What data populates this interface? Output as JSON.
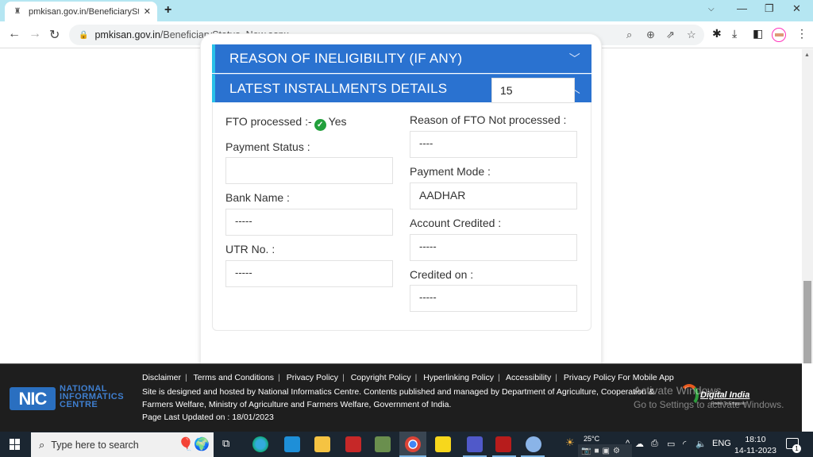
{
  "browser": {
    "tab_title": "pmkisan.gov.in/BeneficiaryStatus",
    "url_domain": "pmkisan.gov.in",
    "url_path": "/BeneficiaryStatus_New.aspx"
  },
  "sections": {
    "ineligibility_title": "REASON OF INELIGIBILITY (IF ANY)",
    "installments_title": "LATEST INSTALLMENTS DETAILS",
    "installment_selected": "15"
  },
  "details": {
    "fto_label": "FTO processed :-",
    "fto_value": "Yes",
    "payment_status_label": "Payment Status :",
    "payment_status_value": "",
    "bank_name_label": "Bank Name :",
    "bank_name_value": "-----",
    "utr_label": "UTR No. :",
    "utr_value": "-----",
    "fto_reason_label": "Reason of FTO Not processed :",
    "fto_reason_value": "----",
    "payment_mode_label": "Payment Mode :",
    "payment_mode_value": "AADHAR",
    "account_credited_label": "Account Credited :",
    "account_credited_value": "-----",
    "credited_on_label": "Credited on :",
    "credited_on_value": "-----"
  },
  "footer": {
    "links": [
      "Disclaimer",
      "Terms and Conditions",
      "Privacy Policy",
      "Copyright Policy",
      "Hyperlinking Policy",
      "Accessibility",
      "Privacy Policy For Mobile App"
    ],
    "line1": "Site is designed and hosted by National Informatics Centre. Contents published and managed by Department of Agriculture, Cooperation &",
    "line2": "Farmers Welfare, Ministry of Agriculture and Farmers Welfare, Government of India.",
    "updated": "Page Last Updated on : 18/01/2023",
    "nic_logo": "NIC",
    "nic_name_1": "NATIONAL",
    "nic_name_2": "INFORMATICS",
    "nic_name_3": "CENTRE",
    "digital_india": "Digital India",
    "digital_india_tag": "Power To Empower"
  },
  "watermark": {
    "line1": "Activate Windows",
    "line2": "Go to Settings to activate Windows."
  },
  "taskbar": {
    "search_placeholder": "Type here to search",
    "weather": "25°C",
    "language": "ENG",
    "time": "18:10",
    "date": "14-11-2023",
    "notifications": "1"
  }
}
